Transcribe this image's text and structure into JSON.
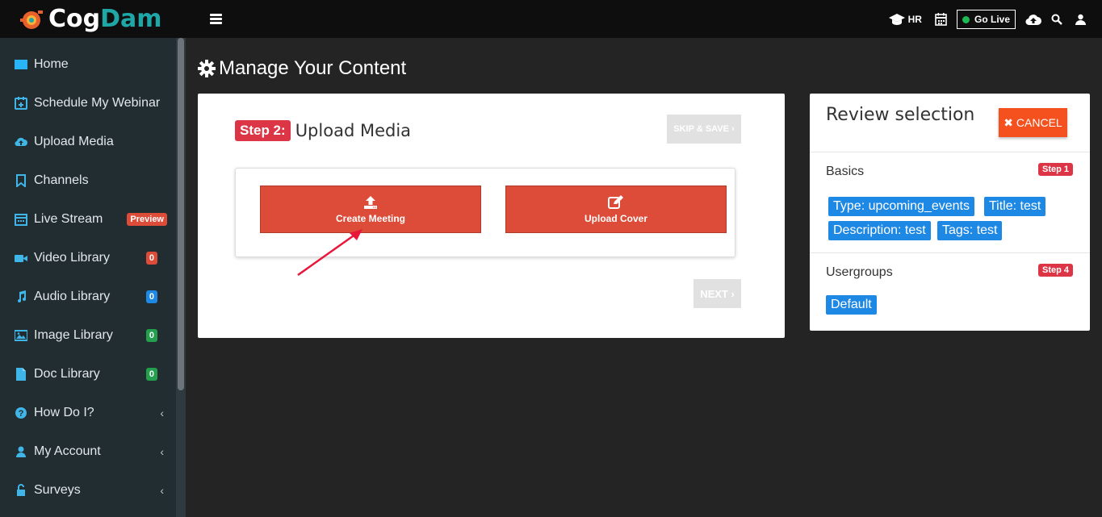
{
  "brand": {
    "name_part1": "Cog",
    "name_part2": "Dam"
  },
  "sidebar": {
    "items": [
      {
        "label": "Home",
        "icon": "monitor-icon"
      },
      {
        "label": "Schedule My Webinar",
        "icon": "calendar-plus-icon"
      },
      {
        "label": "Upload Media",
        "icon": "cloud-upload-icon"
      },
      {
        "label": "Channels",
        "icon": "bookmark-icon"
      },
      {
        "label": "Live Stream",
        "icon": "calendar-icon",
        "badge": "Preview"
      },
      {
        "label": "Video Library",
        "icon": "video-camera-icon",
        "badge": "0"
      },
      {
        "label": "Audio Library",
        "icon": "music-note-icon",
        "badge": "0"
      },
      {
        "label": "Image Library",
        "icon": "image-icon",
        "badge": "0"
      },
      {
        "label": "Doc Library",
        "icon": "document-icon",
        "badge": "0"
      },
      {
        "label": "How Do I?",
        "icon": "question-circle-icon"
      },
      {
        "label": "My Account",
        "icon": "user-icon"
      },
      {
        "label": "Surveys",
        "icon": "lock-icon"
      }
    ]
  },
  "topbar": {
    "hr_label": "HR",
    "golive_label": "Go Live"
  },
  "page": {
    "title": "Manage Your Content"
  },
  "step": {
    "label": "Step 2:",
    "title": "Upload Media",
    "skip_label": "SKIP & SAVE ›",
    "create_meeting_label": "Create Meeting",
    "upload_cover_label": "Upload Cover",
    "next_label": "NEXT ›"
  },
  "review": {
    "title": "Review selection",
    "cancel_label": "✖ CANCEL",
    "basics_label": "Basics",
    "basics_step": "Step 1",
    "basics_tags": [
      "Type: upcoming_events",
      "Title: test",
      "Description: test",
      "Tags: test"
    ],
    "usergroups_label": "Usergroups",
    "usergroups_step": "Step 4",
    "usergroups_tags": [
      "Default"
    ]
  },
  "colors": {
    "accent_red": "#dd4b39",
    "step_red": "#dc3545",
    "tag_blue": "#1e88e5",
    "cancel_orange": "#f4511e",
    "icon_blue": "#3fb5e8"
  }
}
